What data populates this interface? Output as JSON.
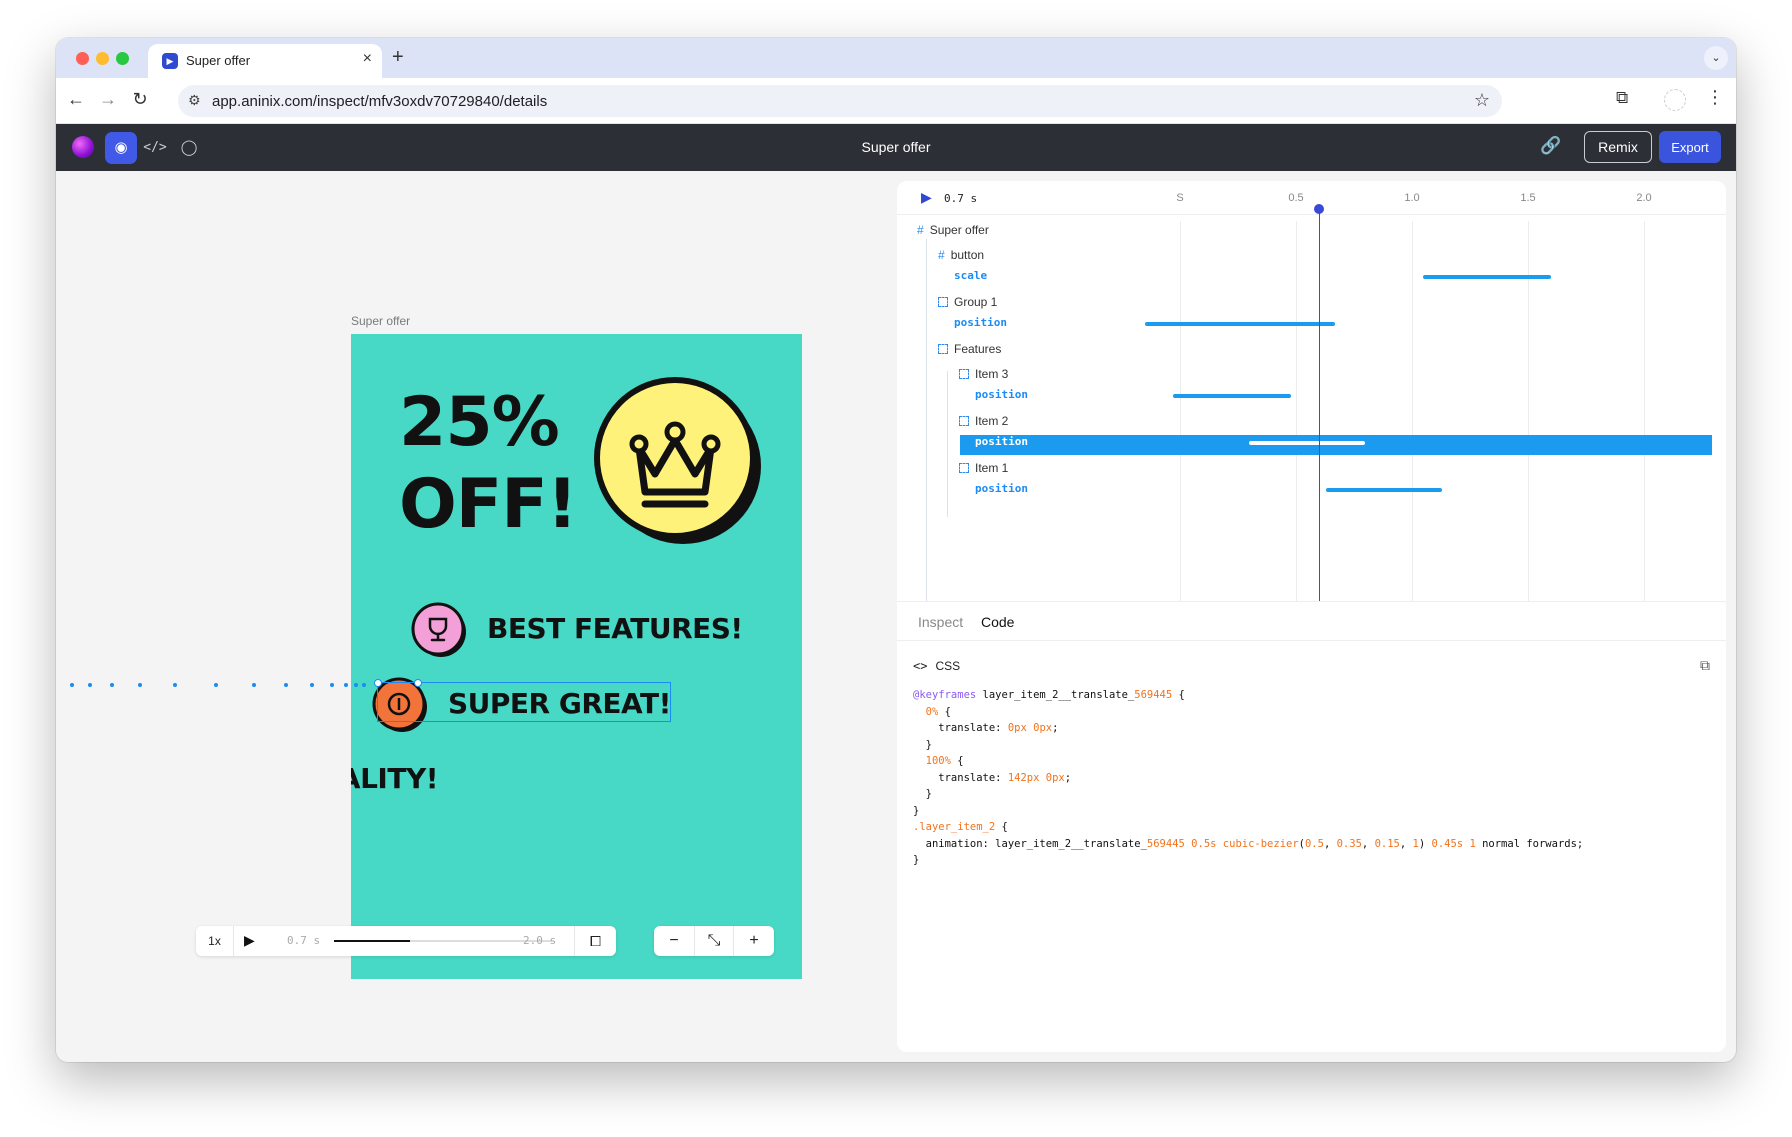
{
  "browser": {
    "tab_title": "Super offer",
    "url": "app.aninix.com/inspect/mfv3oxdv70729840/details"
  },
  "app": {
    "title": "Super offer",
    "remix_label": "Remix",
    "export_label": "Export"
  },
  "canvas": {
    "artboard_label": "Super offer",
    "headline_line1": "25%",
    "headline_line2": "OFF!",
    "features": [
      "BEST FEATURES!",
      "SUPER GREAT!",
      "JALITY!"
    ],
    "colors": {
      "background": "#47d9c6",
      "crown_badge": "#fff27a",
      "trophy_badge": "#f4a0d8",
      "coin_badge": "#f2743a"
    }
  },
  "playback": {
    "speed": "1x",
    "current_time": "0.7 s",
    "end_time": "2.0 s",
    "progress": 0.35
  },
  "timeline": {
    "current_time": "0.7 s",
    "ticks": [
      "S",
      "0.5",
      "1.0",
      "1.5",
      "2.0"
    ],
    "playhead_seconds": 0.75,
    "rows": [
      {
        "label": "Super offer",
        "kind": "frame"
      },
      {
        "label": "button",
        "kind": "frame"
      },
      {
        "label": "scale",
        "kind": "property",
        "start": 1.2,
        "end": 1.75
      },
      {
        "label": "Group 1",
        "kind": "group"
      },
      {
        "label": "position",
        "kind": "property",
        "start": 0.0,
        "end": 0.82
      },
      {
        "label": "Features",
        "kind": "group"
      },
      {
        "label": "Item 3",
        "kind": "group"
      },
      {
        "label": "position",
        "kind": "property",
        "start": 0.12,
        "end": 0.63
      },
      {
        "label": "Item 2",
        "kind": "group"
      },
      {
        "label": "position",
        "kind": "property",
        "start": 0.45,
        "end": 0.95,
        "selected": true
      },
      {
        "label": "Item 1",
        "kind": "group"
      },
      {
        "label": "position",
        "kind": "property",
        "start": 0.78,
        "end": 1.28
      }
    ]
  },
  "panel": {
    "tab_inspect": "Inspect",
    "tab_code": "Code",
    "code_lang": "CSS",
    "code_lines": [
      "@keyframes layer_item_2__translate_569445 {",
      "  0% {",
      "    translate: 0px 0px;",
      "  }",
      "  100% {",
      "    translate: 142px 0px;",
      "  }",
      "}",
      ".layer_item_2 {",
      "  animation: layer_item_2__translate_569445 0.5s cubic-bezier(0.5, 0.35, 0.15, 1) 0.45s 1 normal forwards;",
      "}"
    ]
  }
}
